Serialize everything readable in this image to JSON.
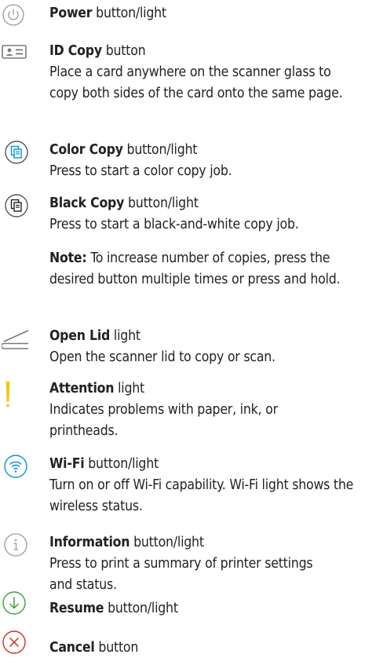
{
  "colors": {
    "accent": "#0096d6",
    "attention": "#f5c400",
    "icon_gray": "#7a7a7a",
    "text": "#222222"
  },
  "items": [
    {
      "icon": "power-icon",
      "name": "Power",
      "suffix": " button/light",
      "desc": ""
    },
    {
      "icon": "id-card-icon",
      "name": "ID Copy",
      "suffix": " button",
      "desc": "Place a card anywhere on the scanner glass to copy both sides of the card onto the same page."
    },
    {
      "icon": "color-copy-icon",
      "name": "Color Copy",
      "suffix": " button/light",
      "desc": "Press to start a color copy job."
    },
    {
      "icon": "black-copy-icon",
      "name": "Black Copy",
      "suffix": " button/light",
      "desc": "Press to start a black-and-white copy job."
    },
    {
      "icon": "open-lid-icon",
      "name": "Open Lid",
      "suffix": " light",
      "desc": "Open the scanner lid to copy or scan."
    },
    {
      "icon": "attention-icon",
      "name": "Attention",
      "suffix": " light",
      "desc": "Indicates problems with paper, ink, or printheads."
    },
    {
      "icon": "wifi-icon",
      "name": "Wi-Fi",
      "suffix": " button/light",
      "desc": "Turn on or off Wi-Fi capability. Wi-Fi light shows the wireless status."
    },
    {
      "icon": "information-icon",
      "name": "Information",
      "suffix": " button/light",
      "desc": "Press to print a summary of printer settings and status."
    },
    {
      "icon": "resume-icon",
      "name": "Resume",
      "suffix": " button/light",
      "desc": ""
    },
    {
      "icon": "cancel-icon",
      "name": "Cancel",
      "suffix": " button",
      "desc": ""
    }
  ],
  "note": {
    "label": "Note:",
    "text": " To increase number of copies, press the desired button multiple times or press and hold."
  }
}
